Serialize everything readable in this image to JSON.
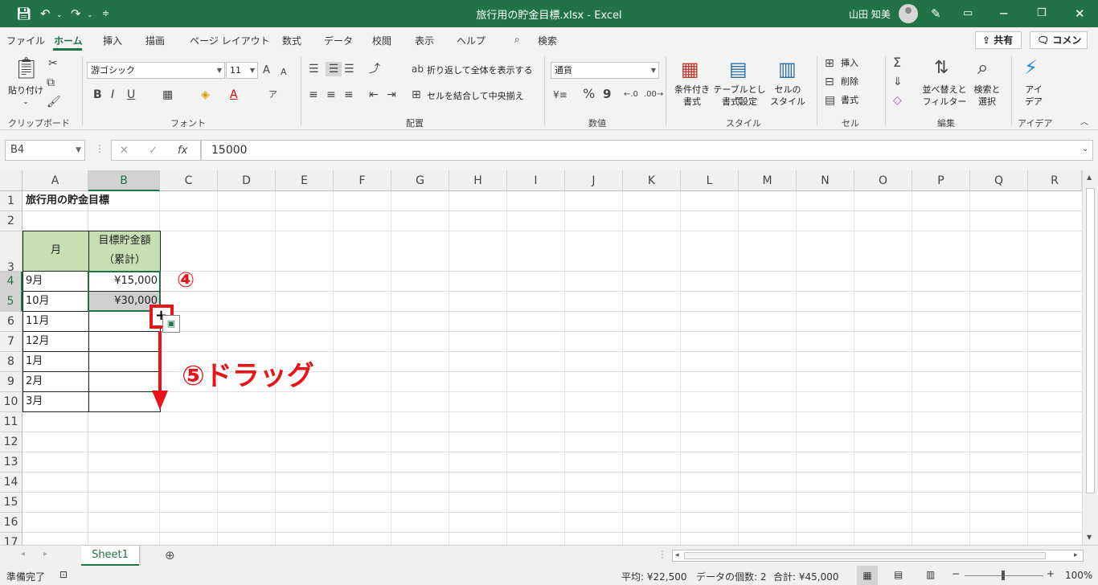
{
  "titlebar": {
    "title": "旅行用の貯金目標.xlsx  -  Excel",
    "user": "山田 知美",
    "icons": [
      "save-icon",
      "undo-icon",
      "redo-icon",
      "customize-icon",
      "avatar",
      "pen-icon",
      "ribbon-display-icon",
      "minimize-icon",
      "restore-icon",
      "close-icon"
    ]
  },
  "menu": {
    "tabs": [
      "ファイル",
      "ホーム",
      "挿入",
      "描画",
      "ページ レイアウト",
      "数式",
      "データ",
      "校閲",
      "表示",
      "ヘルプ"
    ],
    "search": "検索",
    "share": "共有",
    "comment": "コメント"
  },
  "ribbon": {
    "clipboard": {
      "paste": "貼り付け",
      "label": "クリップボード"
    },
    "font": {
      "name": "游ゴシック",
      "size": "11",
      "label": "フォント",
      "bold": "B",
      "italic": "I",
      "underline": "U",
      "grow": "A",
      "shrink": "A"
    },
    "alignment": {
      "wrap": "折り返して全体を表示する",
      "merge": "セルを結合して中央揃え",
      "label": "配置"
    },
    "number": {
      "format": "通貨",
      "label": "数値",
      "percent": "%",
      "comma": "9"
    },
    "styles": {
      "conditional": [
        "条件付き",
        "書式"
      ],
      "table": [
        "テーブルとして",
        "書式設定"
      ],
      "cell": [
        "セルの",
        "スタイル"
      ],
      "label": "スタイル"
    },
    "cells": {
      "insert": "挿入",
      "delete": "削除",
      "format": "書式",
      "label": "セル"
    },
    "editing": {
      "sort": [
        "並べ替えと",
        "フィルター"
      ],
      "find": [
        "検索と",
        "選択"
      ],
      "label": "編集"
    },
    "ideas": {
      "text": [
        "アイ",
        "デア"
      ],
      "label": "アイデア"
    }
  },
  "formula_bar": {
    "name_box": "B4",
    "formula": "15000",
    "fx": "fx"
  },
  "grid": {
    "columns": [
      "A",
      "B",
      "C",
      "D",
      "E",
      "F",
      "G",
      "H",
      "I",
      "J",
      "K",
      "L",
      "M",
      "N",
      "O",
      "P",
      "Q",
      "R"
    ],
    "rows": [
      "1",
      "2",
      "3",
      "4",
      "5",
      "6",
      "7",
      "8",
      "9",
      "10",
      "11",
      "12",
      "13",
      "14",
      "15",
      "16",
      "17"
    ],
    "title": "旅行用の貯金目標",
    "header_month": "月",
    "header_target": [
      "目標貯金額",
      "（累計）"
    ],
    "months": [
      "9月",
      "10月",
      "11月",
      "12月",
      "1月",
      "2月",
      "3月"
    ],
    "values": [
      "¥15,000",
      "¥30,000"
    ]
  },
  "callouts": {
    "step4": "④",
    "step5": "⑤ドラッグ"
  },
  "sheets": {
    "active": "Sheet1"
  },
  "status": {
    "ready": "準備完了",
    "average": "平均: ¥22,500",
    "count": "データの個数: 2",
    "sum": "合計: ¥45,000",
    "zoom": "100%"
  },
  "colors": {
    "accent": "#217346",
    "header_fill": "#c6e0b4",
    "callout": "#e8141c"
  }
}
